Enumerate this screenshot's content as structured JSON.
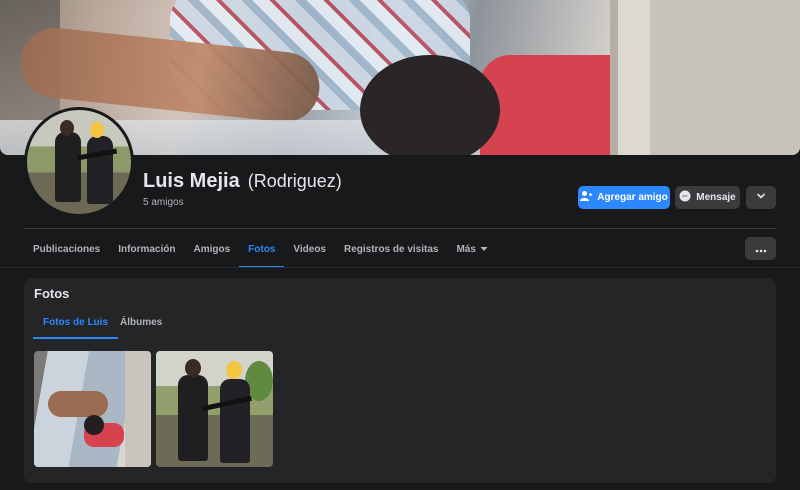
{
  "profile": {
    "name": "Luis Mejia",
    "alternate_name": "(Rodriguez)",
    "friends_count": "5 amigos"
  },
  "actions": {
    "add_friend": "Agregar amigo",
    "message": "Mensaje"
  },
  "tabs": [
    {
      "label": "Publicaciones"
    },
    {
      "label": "Información"
    },
    {
      "label": "Amigos"
    },
    {
      "label": "Fotos"
    },
    {
      "label": "Videos"
    },
    {
      "label": "Registros de visitas"
    },
    {
      "label": "Más"
    }
  ],
  "active_tab": "Fotos",
  "photos_section": {
    "title": "Fotos",
    "subtabs": [
      {
        "label": "Fotos de Luis"
      },
      {
        "label": "Álbumes"
      }
    ]
  },
  "colors": {
    "accent": "#2d88ff",
    "background": "#18191a",
    "card": "#242526"
  }
}
